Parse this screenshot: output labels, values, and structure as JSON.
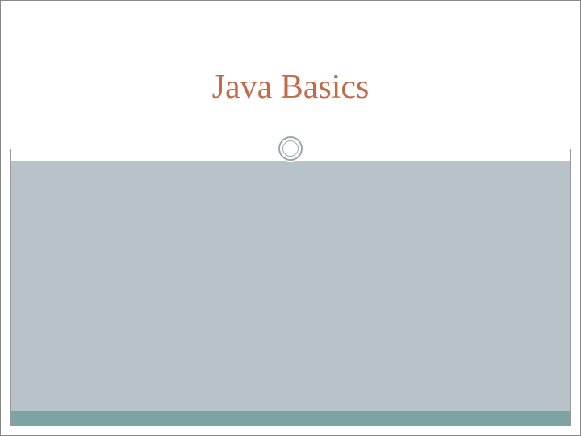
{
  "slide": {
    "title": "Java Basics"
  },
  "colors": {
    "title_color": "#c26a4a",
    "body_bg": "#b7c3c9",
    "footer_bg": "#7ea3a3",
    "circle_border": "#9aa8ae"
  }
}
